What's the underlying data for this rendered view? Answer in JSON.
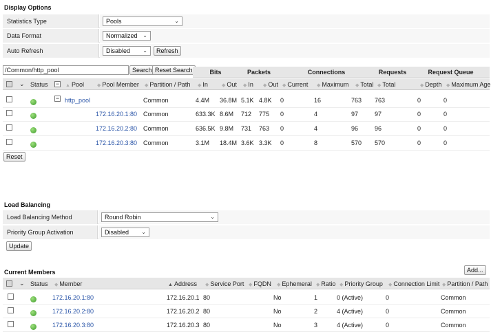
{
  "display_options": {
    "title": "Display Options",
    "rows": [
      {
        "label": "Statistics Type",
        "value": "Pools"
      },
      {
        "label": "Data Format",
        "value": "Normalized"
      },
      {
        "label": "Auto Refresh",
        "value": "Disabled",
        "button": "Refresh"
      }
    ]
  },
  "stats": {
    "search_value": "/Common/http_pool",
    "search_button": "Search",
    "reset_search_button": "Reset Search",
    "groups": [
      "Bits",
      "Packets",
      "Connections",
      "Requests",
      "Request Queue"
    ],
    "columns": [
      "Status",
      "Pool",
      "Pool Member",
      "Partition / Path",
      "In",
      "Out",
      "In",
      "Out",
      "Current",
      "Maximum",
      "Total",
      "Total",
      "Depth",
      "Maximum Age"
    ],
    "rows": [
      {
        "pool": "http_pool",
        "member": "",
        "partition": "Common",
        "bits_in": "4.4M",
        "bits_out": "36.8M",
        "pk_in": "5.1K",
        "pk_out": "4.8K",
        "current": "0",
        "maximum": "16",
        "total": "763",
        "req_total": "763",
        "depth": "0",
        "max_age": "0"
      },
      {
        "pool": "",
        "member": "172.16.20.1:80",
        "partition": "Common",
        "bits_in": "633.3K",
        "bits_out": "8.6M",
        "pk_in": "712",
        "pk_out": "775",
        "current": "0",
        "maximum": "4",
        "total": "97",
        "req_total": "97",
        "depth": "0",
        "max_age": "0"
      },
      {
        "pool": "",
        "member": "172.16.20.2:80",
        "partition": "Common",
        "bits_in": "636.5K",
        "bits_out": "9.8M",
        "pk_in": "731",
        "pk_out": "763",
        "current": "0",
        "maximum": "4",
        "total": "96",
        "req_total": "96",
        "depth": "0",
        "max_age": "0"
      },
      {
        "pool": "",
        "member": "172.16.20.3:80",
        "partition": "Common",
        "bits_in": "3.1M",
        "bits_out": "18.4M",
        "pk_in": "3.6K",
        "pk_out": "3.3K",
        "current": "0",
        "maximum": "8",
        "total": "570",
        "req_total": "570",
        "depth": "0",
        "max_age": "0"
      }
    ],
    "reset_button": "Reset"
  },
  "load_balancing": {
    "title": "Load Balancing",
    "rows": [
      {
        "label": "Load Balancing Method",
        "value": "Round Robin"
      },
      {
        "label": "Priority Group Activation",
        "value": "Disabled"
      }
    ],
    "update_button": "Update"
  },
  "members": {
    "title": "Current Members",
    "add_button": "Add...",
    "columns": [
      "Status",
      "Member",
      "Address",
      "Service Port",
      "FQDN",
      "Ephemeral",
      "Ratio",
      "Priority Group",
      "Connection Limit",
      "Partition / Path"
    ],
    "rows": [
      {
        "member": "172.16.20.1:80",
        "address": "172.16.20.1",
        "port": "80",
        "fqdn": "",
        "ephemeral": "No",
        "ratio": "1",
        "priority": "0 (Active)",
        "limit": "0",
        "partition": "Common"
      },
      {
        "member": "172.16.20.2:80",
        "address": "172.16.20.2",
        "port": "80",
        "fqdn": "",
        "ephemeral": "No",
        "ratio": "2",
        "priority": "4 (Active)",
        "limit": "0",
        "partition": "Common"
      },
      {
        "member": "172.16.20.3:80",
        "address": "172.16.20.3",
        "port": "80",
        "fqdn": "",
        "ephemeral": "No",
        "ratio": "3",
        "priority": "4 (Active)",
        "limit": "0",
        "partition": "Common"
      }
    ]
  }
}
